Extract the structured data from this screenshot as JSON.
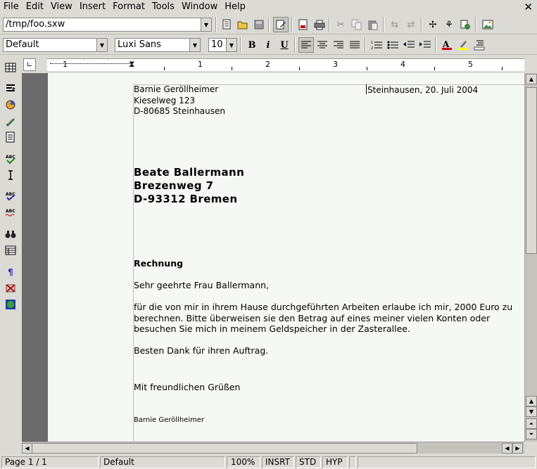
{
  "menubar": {
    "items": [
      {
        "label": "File"
      },
      {
        "label": "Edit"
      },
      {
        "label": "View"
      },
      {
        "label": "Insert"
      },
      {
        "label": "Format"
      },
      {
        "label": "Tools"
      },
      {
        "label": "Window"
      },
      {
        "label": "Help"
      }
    ],
    "close_glyph": "✕"
  },
  "toolbar": {
    "url_value": "/tmp/foo.sxw"
  },
  "format_bar": {
    "style_value": "Default",
    "font_value": "Luxi Sans",
    "size_value": "10",
    "bold_label": "B",
    "italic_label": "i",
    "underline_label": "U"
  },
  "ruler": {
    "numbers": [
      "1",
      "1",
      "2",
      "3",
      "4",
      "5"
    ]
  },
  "document": {
    "sender": [
      "Barnie Geröllheimer",
      "Kieselweg 123",
      "D-80685 Steinhausen"
    ],
    "date_line": "Steinhausen, 20. Juli 2004",
    "recipient": [
      "Beate Ballermann",
      "Brezenweg 7",
      "D-93312 Bremen"
    ],
    "subject": "Rechnung",
    "salutation": "Sehr geehrte Frau Ballermann,",
    "paragraph": [
      "für die von mir in ihrem Hause durchgeführten Arbeiten erlaube ich mir, 2000 Euro zu",
      "berechnen. Bitte überweisen sie den Betrag auf eines meiner vielen Konten oder",
      "besuchen Sie mich in meinem Geldspeicher in der Zasterallee."
    ],
    "thanks": "Besten Dank für ihren Auftrag.",
    "closing": "Mit freundlichen Grüßen",
    "signature": "Barnie Geröllheimer"
  },
  "statusbar": {
    "page": "Page 1 / 1",
    "style": "Default",
    "zoom": "100%",
    "insert_mode": "INSRT",
    "selection_mode": "STD",
    "hyperlink_mode": "HYP"
  },
  "colors": {
    "font_color_accent": "#cc0000",
    "highlight_accent": "#ffff00",
    "page_background": "#f5f8f5",
    "doc_backdrop": "#6b6b6b"
  },
  "icons": {
    "toolbar": [
      "edit-file-icon",
      "open-icon",
      "save-icon",
      "edit-mode-icon",
      "export-pdf-icon",
      "print-icon",
      "cut-icon",
      "copy-icon",
      "paste-icon",
      "undo-icon",
      "redo-icon",
      "navigator-icon",
      "stylist-icon",
      "hyperlink-icon",
      "gallery-icon"
    ],
    "left": [
      "insert-table-icon",
      "insert-fields-icon",
      "insert-object-icon",
      "show-draw-functions-icon",
      "form-functions-icon",
      "text-autocomplete-icon",
      "direct-cursor-icon",
      "spellcheck-icon",
      "autospellcheck-icon",
      "find-icon",
      "data-sources-icon",
      "nonprinting-chars-icon",
      "graphics-off-icon",
      "online-layout-icon"
    ]
  }
}
